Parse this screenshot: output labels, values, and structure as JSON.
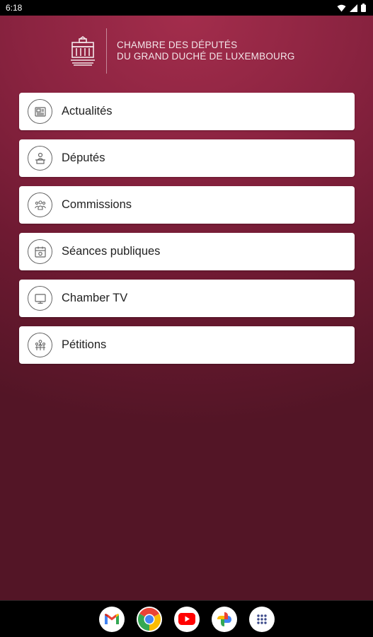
{
  "status_bar": {
    "time": "6:18",
    "wifi_icon": "wifi-icon",
    "signal_icon": "signal-icon",
    "battery_icon": "battery-icon"
  },
  "header": {
    "title_line1": "CHAMBRE DES DÉPUTÉS",
    "title_line2": "DU GRAND DUCHÉ DE LUXEMBOURG",
    "logo_icon": "chamber-building-logo"
  },
  "menu": {
    "items": [
      {
        "label": "Actualités",
        "icon": "newspaper-icon"
      },
      {
        "label": "Députés",
        "icon": "deputy-speaker-icon"
      },
      {
        "label": "Commissions",
        "icon": "group-people-icon"
      },
      {
        "label": "Séances publiques",
        "icon": "calendar-session-icon"
      },
      {
        "label": "Chamber TV",
        "icon": "tv-monitor-icon"
      },
      {
        "label": "Pétitions",
        "icon": "petition-people-icon"
      }
    ]
  },
  "dock": {
    "apps": [
      "gmail-icon",
      "chrome-icon",
      "youtube-icon",
      "photos-icon",
      "app-drawer-icon"
    ]
  },
  "colors": {
    "background_top": "#a32d4c",
    "background_bottom": "#531526",
    "card": "#ffffff",
    "text": "#222222"
  }
}
